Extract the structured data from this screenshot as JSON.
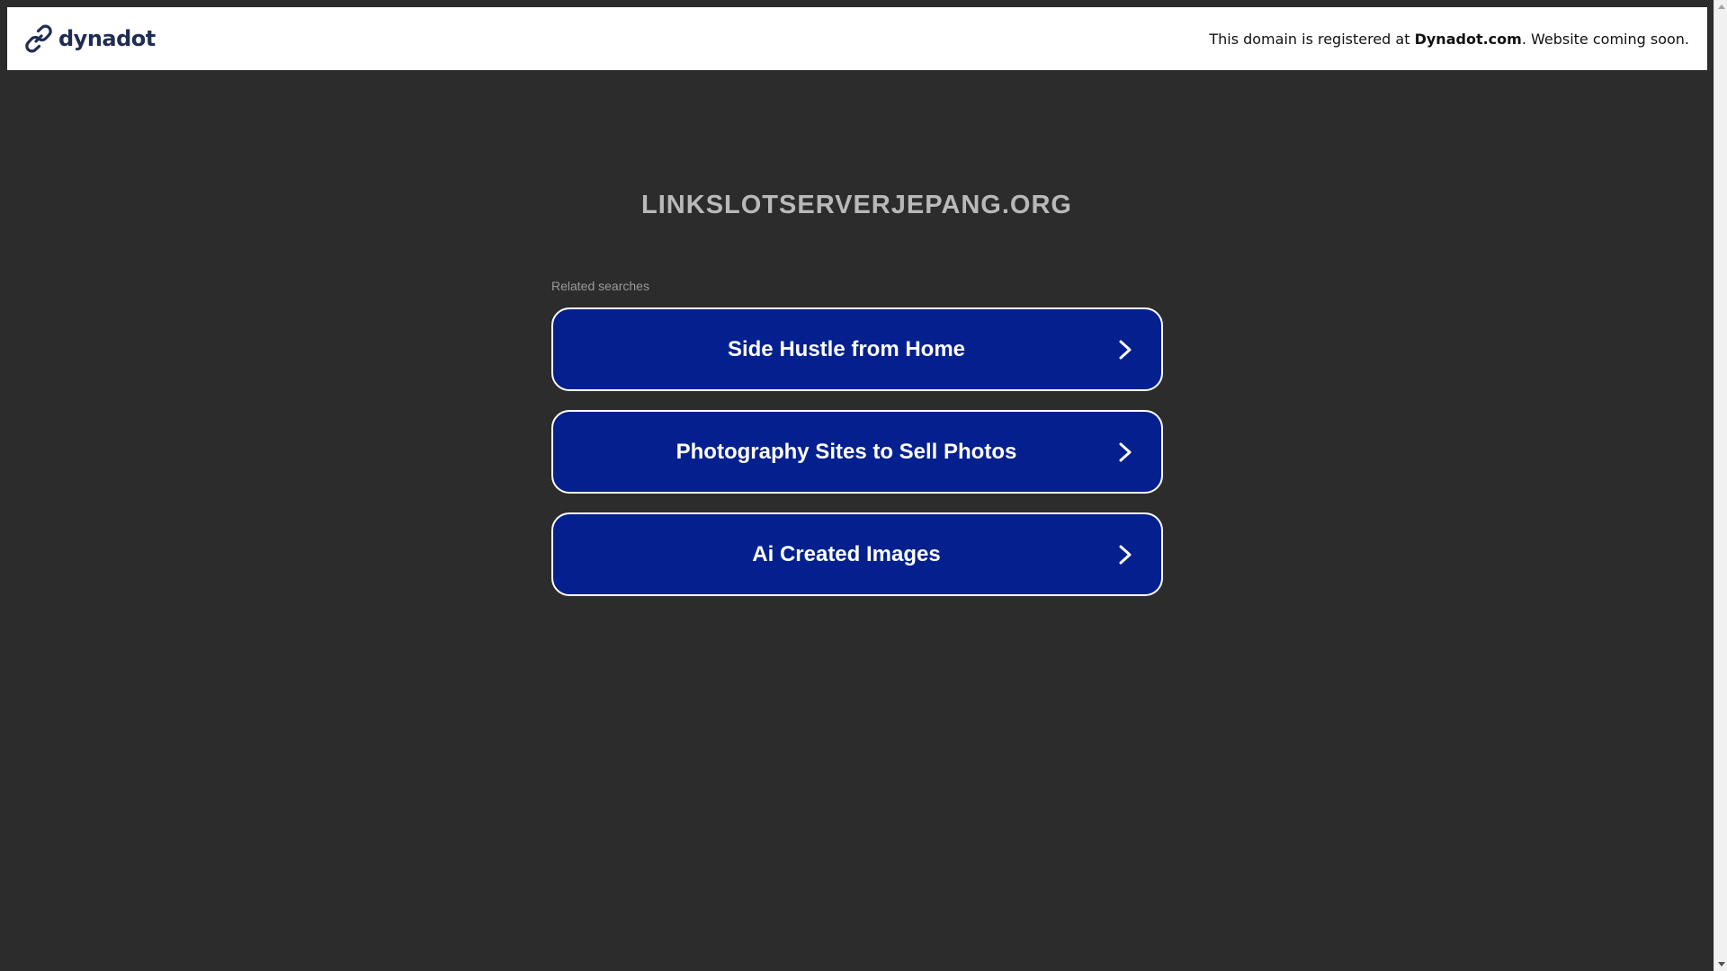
{
  "header": {
    "logo_text": "dynadot",
    "notice_prefix": "This domain is registered at ",
    "notice_brand": "Dynadot.com",
    "notice_suffix": ". Website coming soon."
  },
  "main": {
    "domain": "LINKSLOTSERVERJEPANG.ORG",
    "related_label": "Related searches",
    "searches": [
      {
        "label": "Side Hustle from Home"
      },
      {
        "label": "Photography Sites to Sell Photos"
      },
      {
        "label": "Ai Created Images"
      }
    ]
  },
  "colors": {
    "background": "#2c2c2c",
    "header_bg": "#ffffff",
    "button_bg": "#04208e",
    "logo_color": "#1f2d52",
    "title_color": "#b9b9b9"
  },
  "icons": {
    "logo": "dynadot-link-icon",
    "button_arrow": "chevron-right-icon"
  }
}
